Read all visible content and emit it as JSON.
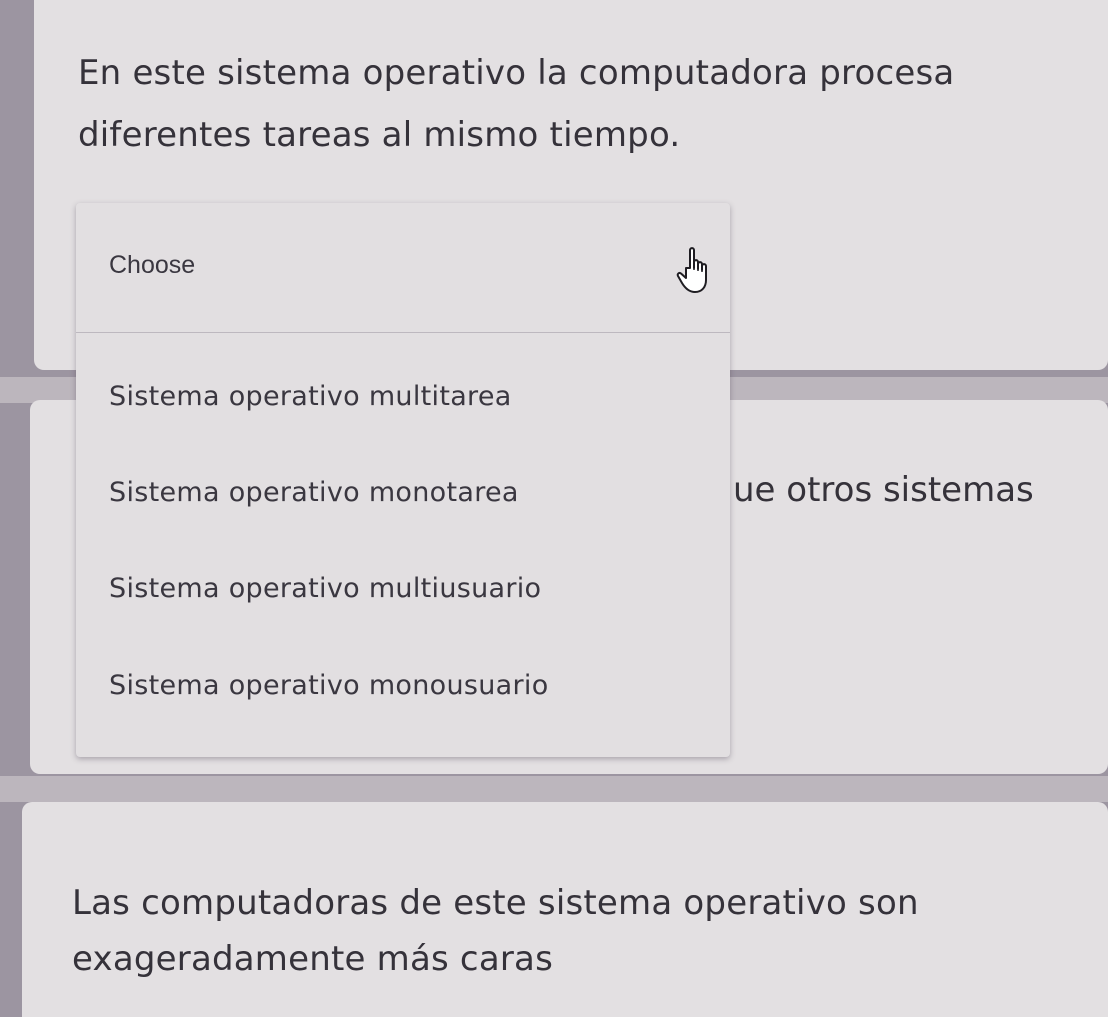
{
  "question_1": {
    "line_1": "En este sistema operativo la computadora procesa",
    "line_2": "diferentes tareas al mismo tiempo."
  },
  "dropdown": {
    "placeholder": "Choose",
    "options": [
      "Sistema operativo multitarea",
      "Sistema operativo monotarea",
      "Sistema operativo multiusuario",
      "Sistema operativo monousuario"
    ]
  },
  "question_2": {
    "visible_fragment": "ue otros sistemas"
  },
  "question_3": {
    "line_1": "Las computadoras de este sistema operativo son",
    "line_2": "exageradamente más caras"
  },
  "icons": {
    "cursor": "pointing-hand-cursor-icon"
  },
  "colors": {
    "card_background": "#e3e0e2",
    "page_background": "#9c95a1",
    "text": "#35323a"
  }
}
